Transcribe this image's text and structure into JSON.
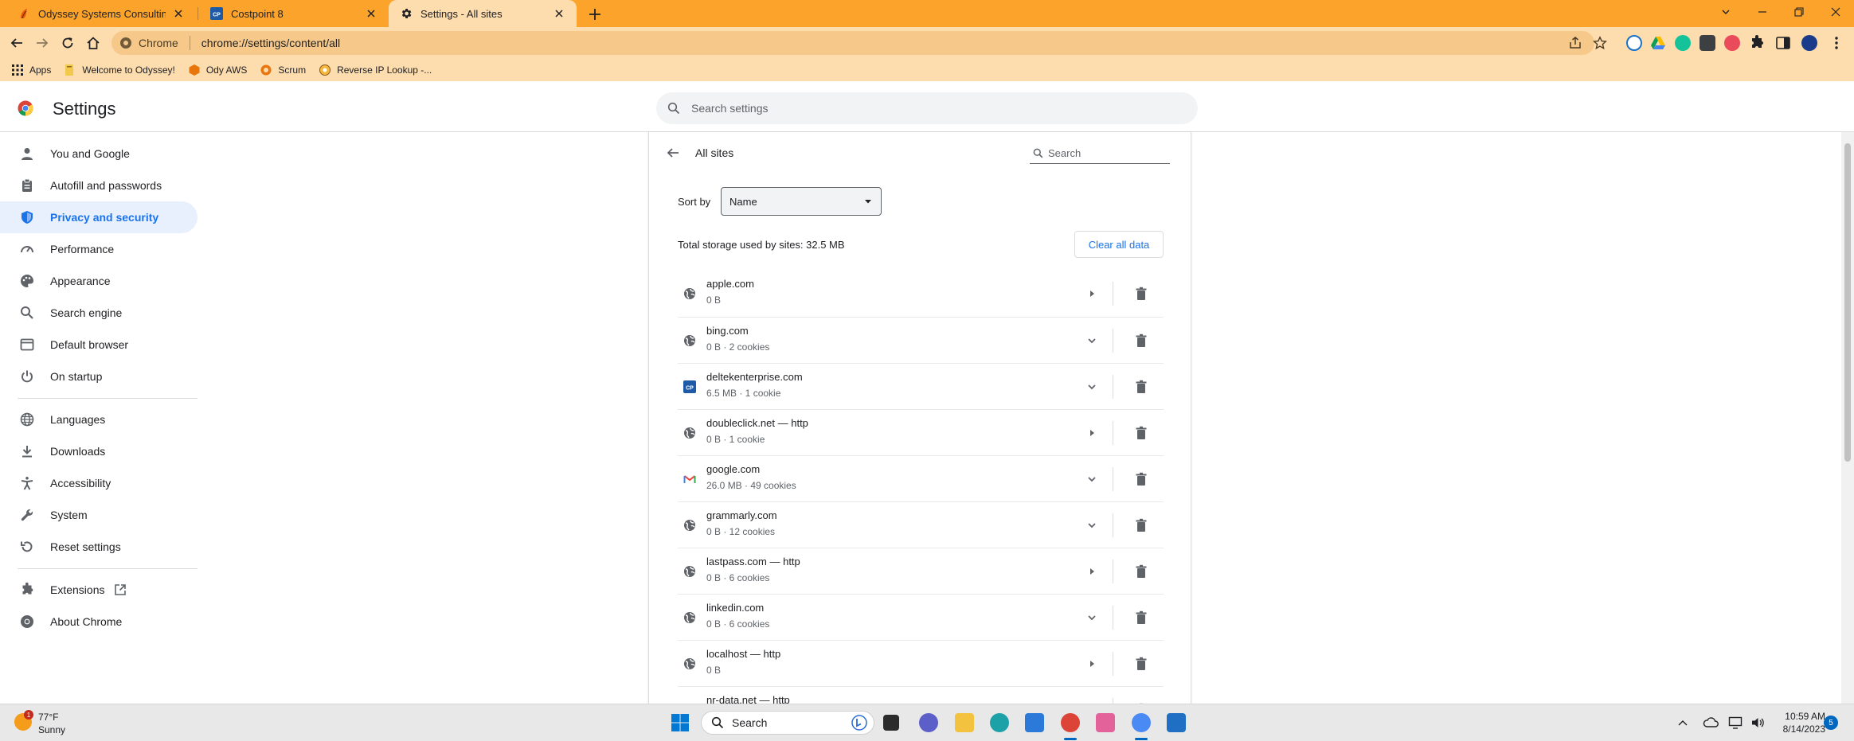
{
  "tabs": [
    {
      "title": "Odyssey Systems Consulting Gro",
      "favicon": "odyssey-icon",
      "active": false
    },
    {
      "title": "Costpoint 8",
      "favicon": "costpoint-icon",
      "active": false
    },
    {
      "title": "Settings - All sites",
      "favicon": "settings-icon",
      "active": true
    }
  ],
  "omnibox": {
    "chip": "Chrome",
    "url": "chrome://settings/content/all"
  },
  "bookmarks": [
    {
      "label": "Apps",
      "icon": "apps-grid-icon"
    },
    {
      "label": "Welcome to Odyssey!",
      "icon": "folder-icon"
    },
    {
      "label": "Ody AWS",
      "icon": "aws-icon"
    },
    {
      "label": "Scrum",
      "icon": "scrum-icon"
    },
    {
      "label": "Reverse IP Lookup -...",
      "icon": "lookup-icon"
    }
  ],
  "header": {
    "title": "Settings",
    "search_placeholder": "Search settings"
  },
  "sidebar": {
    "items": [
      {
        "label": "You and Google",
        "icon": "person-icon"
      },
      {
        "label": "Autofill and passwords",
        "icon": "clipboard-icon"
      },
      {
        "label": "Privacy and security",
        "icon": "shield-icon",
        "selected": true
      },
      {
        "label": "Performance",
        "icon": "speedometer-icon"
      },
      {
        "label": "Appearance",
        "icon": "palette-icon"
      },
      {
        "label": "Search engine",
        "icon": "search-icon"
      },
      {
        "label": "Default browser",
        "icon": "browser-icon"
      },
      {
        "label": "On startup",
        "icon": "power-icon"
      },
      {
        "label": "Languages",
        "icon": "globe-icon"
      },
      {
        "label": "Downloads",
        "icon": "download-icon"
      },
      {
        "label": "Accessibility",
        "icon": "accessibility-icon"
      },
      {
        "label": "System",
        "icon": "wrench-icon"
      },
      {
        "label": "Reset settings",
        "icon": "reset-icon"
      },
      {
        "label": "Extensions",
        "icon": "extension-icon"
      },
      {
        "label": "About Chrome",
        "icon": "chrome-icon"
      }
    ]
  },
  "main": {
    "title": "All sites",
    "search_placeholder": "Search",
    "sort_label": "Sort by",
    "sort_value": "Name",
    "total_storage": "Total storage used by sites: 32.5 MB",
    "clear_all": "Clear all data",
    "sites": [
      {
        "name": "apple.com",
        "meta": "0 B",
        "expand": "arrow",
        "favicon": "globe"
      },
      {
        "name": "bing.com",
        "meta": "0 B · 2 cookies",
        "expand": "chevron",
        "favicon": "globe"
      },
      {
        "name": "deltekenterprise.com",
        "meta": "6.5 MB · 1 cookie",
        "expand": "chevron",
        "favicon": "costpoint"
      },
      {
        "name": "doubleclick.net — http",
        "meta": "0 B · 1 cookie",
        "expand": "arrow",
        "favicon": "globe"
      },
      {
        "name": "google.com",
        "meta": "26.0 MB · 49 cookies",
        "expand": "chevron",
        "favicon": "gmail"
      },
      {
        "name": "grammarly.com",
        "meta": "0 B · 12 cookies",
        "expand": "chevron",
        "favicon": "globe"
      },
      {
        "name": "lastpass.com — http",
        "meta": "0 B · 6 cookies",
        "expand": "arrow",
        "favicon": "globe"
      },
      {
        "name": "linkedin.com",
        "meta": "0 B · 6 cookies",
        "expand": "chevron",
        "favicon": "globe"
      },
      {
        "name": "localhost — http",
        "meta": "0 B",
        "expand": "arrow",
        "favicon": "globe"
      },
      {
        "name": "nr-data.net — http",
        "meta": "",
        "expand": "arrow",
        "favicon": "globe"
      }
    ]
  },
  "taskbar": {
    "weather_temp": "77°F",
    "weather_desc": "Sunny",
    "weather_badge": "1",
    "search_placeholder": "Search",
    "time": "10:59 AM",
    "date": "8/14/2023",
    "notifications": "5"
  },
  "colors": {
    "tabstrip": "#fba32b",
    "toolbar": "#fddcae",
    "accent": "#1a73e8",
    "selected_bg": "#e8f0fe"
  }
}
